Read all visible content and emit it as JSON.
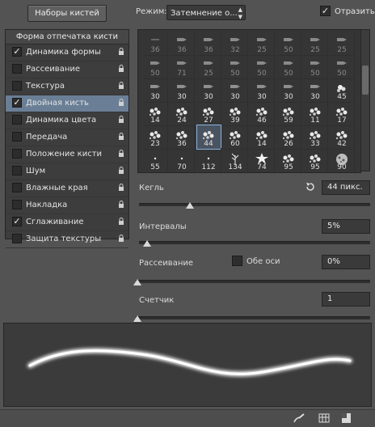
{
  "toolbar": {
    "presets_button": "Наборы кистей",
    "mode_label": "Режим:",
    "mode_value": "Затемнение  о...",
    "flip_label": "Отразить",
    "flip_checked": true
  },
  "sidebar": {
    "header": "Форма отпечатка кисти",
    "items": [
      {
        "label": "Динамика формы",
        "checked": true,
        "selected": false
      },
      {
        "label": "Рассеивание",
        "checked": false,
        "selected": false
      },
      {
        "label": "Текстура",
        "checked": false,
        "selected": false
      },
      {
        "label": "Двойная кисть",
        "checked": true,
        "selected": true
      },
      {
        "label": "Динамика цвета",
        "checked": false,
        "selected": false
      },
      {
        "label": "Передача",
        "checked": false,
        "selected": false
      },
      {
        "label": "Положение кисти",
        "checked": false,
        "selected": false
      },
      {
        "label": "Шум",
        "checked": false,
        "selected": false
      },
      {
        "label": "Влажные края",
        "checked": false,
        "selected": false
      },
      {
        "label": "Накладка",
        "checked": false,
        "selected": false
      },
      {
        "label": "Сглаживание",
        "checked": true,
        "selected": false
      },
      {
        "label": "Защита текстуры",
        "checked": false,
        "selected": false
      }
    ]
  },
  "brush_grid": {
    "rows": [
      [
        "36",
        "36",
        "36",
        "32",
        "25",
        "50",
        "25",
        "25"
      ],
      [
        "50",
        "71",
        "25",
        "50",
        "50",
        "50",
        "50",
        "50"
      ],
      [
        "30",
        "30",
        "30",
        "30",
        "30",
        "30",
        "30",
        "45"
      ],
      [
        "14",
        "24",
        "27",
        "39",
        "46",
        "59",
        "11",
        "17"
      ],
      [
        "23",
        "36",
        "44",
        "60",
        "14",
        "26",
        "33",
        "42"
      ],
      [
        "55",
        "70",
        "112",
        "134",
        "74",
        "95",
        "95",
        "90"
      ]
    ],
    "selected_index": 34
  },
  "params": {
    "size_label": "Кегль",
    "size_value": "44 пикс.",
    "size_level": 0.22,
    "spacing_label": "Интервалы",
    "spacing_value": "5%",
    "spacing_level": 0.02,
    "scatter_label": "Рассеивание",
    "both_axes_label": "Обе оси",
    "scatter_value": "0%",
    "scatter_level": 0.0,
    "count_label": "Счетчик",
    "count_value": "1",
    "count_level": 0.0
  },
  "icons": {
    "reset": "reset-icon",
    "lock": "lock-icon",
    "brush_tool": "brush-tool-icon",
    "grid": "grid-icon",
    "new": "new-preset-icon"
  }
}
